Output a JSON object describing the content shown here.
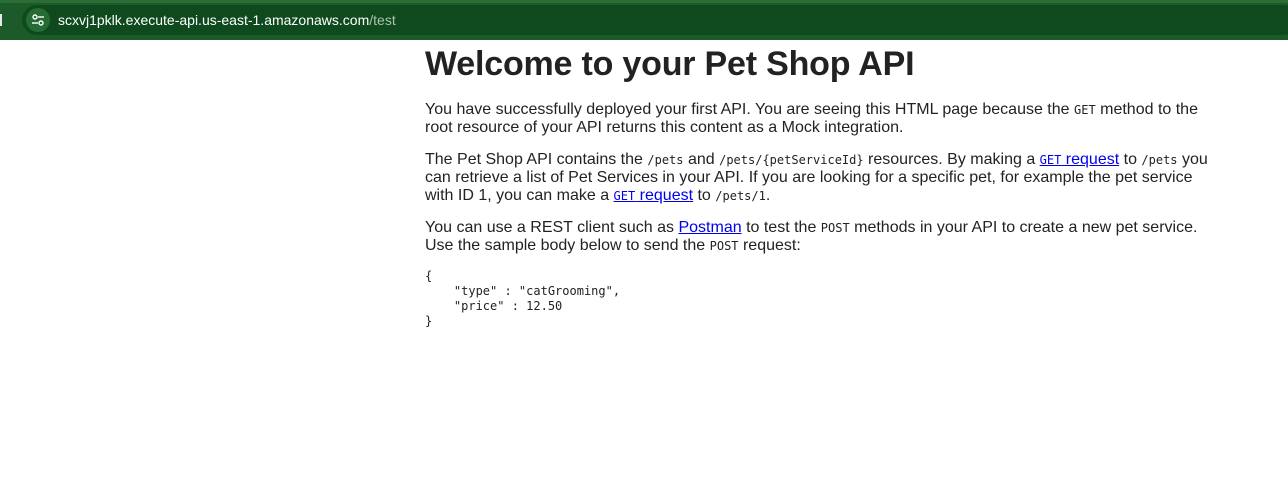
{
  "browser": {
    "url_host": "scxvj1pklk.execute-api.us-east-1.amazonaws.com",
    "url_path": "/test",
    "site_info_icon": "tune-icon"
  },
  "page": {
    "title": "Welcome to your Pet Shop API",
    "p1": {
      "a": "You have successfully deployed your first API. You are seeing this HTML page because the ",
      "code": "GET",
      "b": " method to the root resource of your API returns this content as a Mock integration."
    },
    "p2": {
      "a": "The Pet Shop API contains the ",
      "code1": "/pets",
      "b": " and ",
      "code2": "/pets/{petServiceId}",
      "c": " resources. By making a ",
      "link1_code": "GET",
      "link1_text": " request",
      "d": " to ",
      "code3": "/pets",
      "e": " you can retrieve a list of Pet Services in your API. If you are looking for a specific pet, for example the pet service with ID 1, you can make a ",
      "link2_code": "GET",
      "link2_text": " request",
      "f": " to ",
      "code4": "/pets/1",
      "g": "."
    },
    "p3": {
      "a": "You can use a REST client such as ",
      "link": "Postman",
      "b": " to test the ",
      "code1": "POST",
      "c": " methods in your API to create a new pet service. Use the sample body below to send the ",
      "code2": "POST",
      "d": " request:"
    },
    "sample_body": "{\n    \"type\" : \"catGrooming\",\n    \"price\" : 12.50\n}"
  }
}
